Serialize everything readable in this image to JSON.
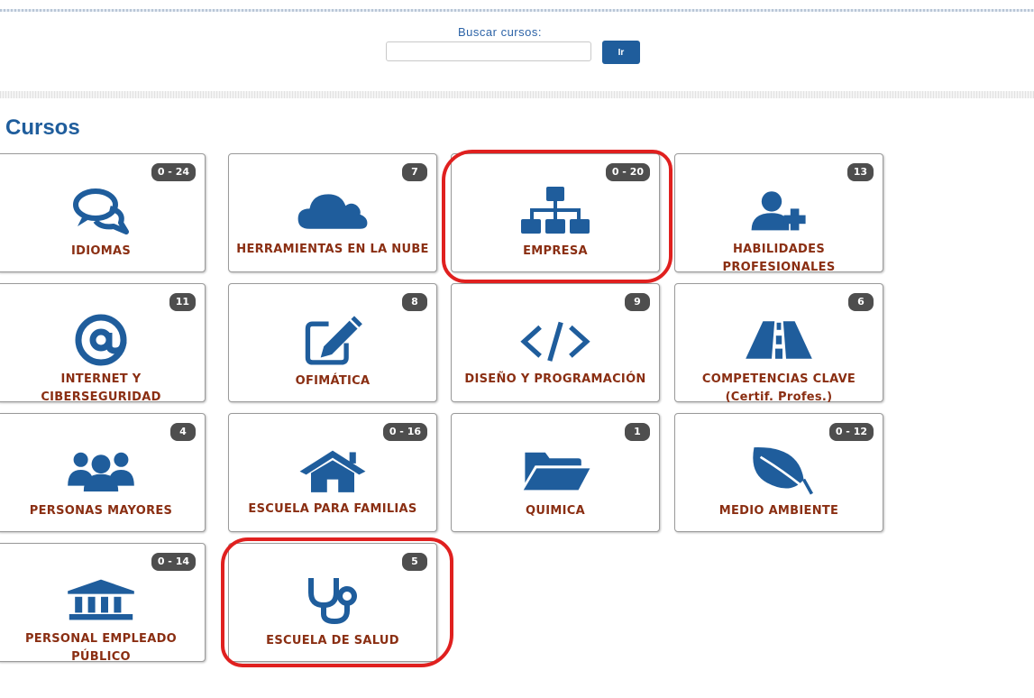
{
  "search": {
    "label": "Buscar cursos:",
    "input_value": "",
    "button_label": "Ir"
  },
  "section": {
    "title": "Cursos"
  },
  "categories": [
    {
      "label": "IDIOMAS",
      "badge": "0 - 24",
      "icon": "chat-bubbles-icon"
    },
    {
      "label": "HERRAMIENTAS EN LA NUBE",
      "badge": "7",
      "icon": "cloud-icon"
    },
    {
      "label": "EMPRESA",
      "badge": "0 - 20",
      "icon": "org-chart-icon"
    },
    {
      "label": "HABILIDADES PROFESIONALES",
      "badge": "13",
      "icon": "user-add-icon"
    },
    {
      "label": "INTERNET Y CIBERSEGURIDAD",
      "badge": "11",
      "icon": "at-sign-icon"
    },
    {
      "label": "OFIMÁTICA",
      "badge": "8",
      "icon": "edit-pencil-icon"
    },
    {
      "label": "DISEÑO Y PROGRAMACIÓN",
      "badge": "9",
      "icon": "code-icon"
    },
    {
      "label": "COMPETENCIAS CLAVE (Certif. Profes.)",
      "badge": "6",
      "icon": "road-icon"
    },
    {
      "label": "PERSONAS MAYORES",
      "badge": "4",
      "icon": "group-icon"
    },
    {
      "label": "ESCUELA PARA FAMILIAS",
      "badge": "0 - 16",
      "icon": "home-icon"
    },
    {
      "label": "QUIMICA",
      "badge": "1",
      "icon": "folder-open-icon"
    },
    {
      "label": "MEDIO AMBIENTE",
      "badge": "0 - 12",
      "icon": "leaf-icon"
    },
    {
      "label": "PERSONAL EMPLEADO PÚBLICO",
      "badge": "0 - 14",
      "icon": "institution-icon"
    },
    {
      "label": "ESCUELA DE SALUD",
      "badge": "5",
      "icon": "stethoscope-icon"
    }
  ],
  "colors": {
    "accent": "#1f5d9c",
    "label": "#8a2e12",
    "badge": "#4e4e4e",
    "highlight": "#e0201f"
  }
}
